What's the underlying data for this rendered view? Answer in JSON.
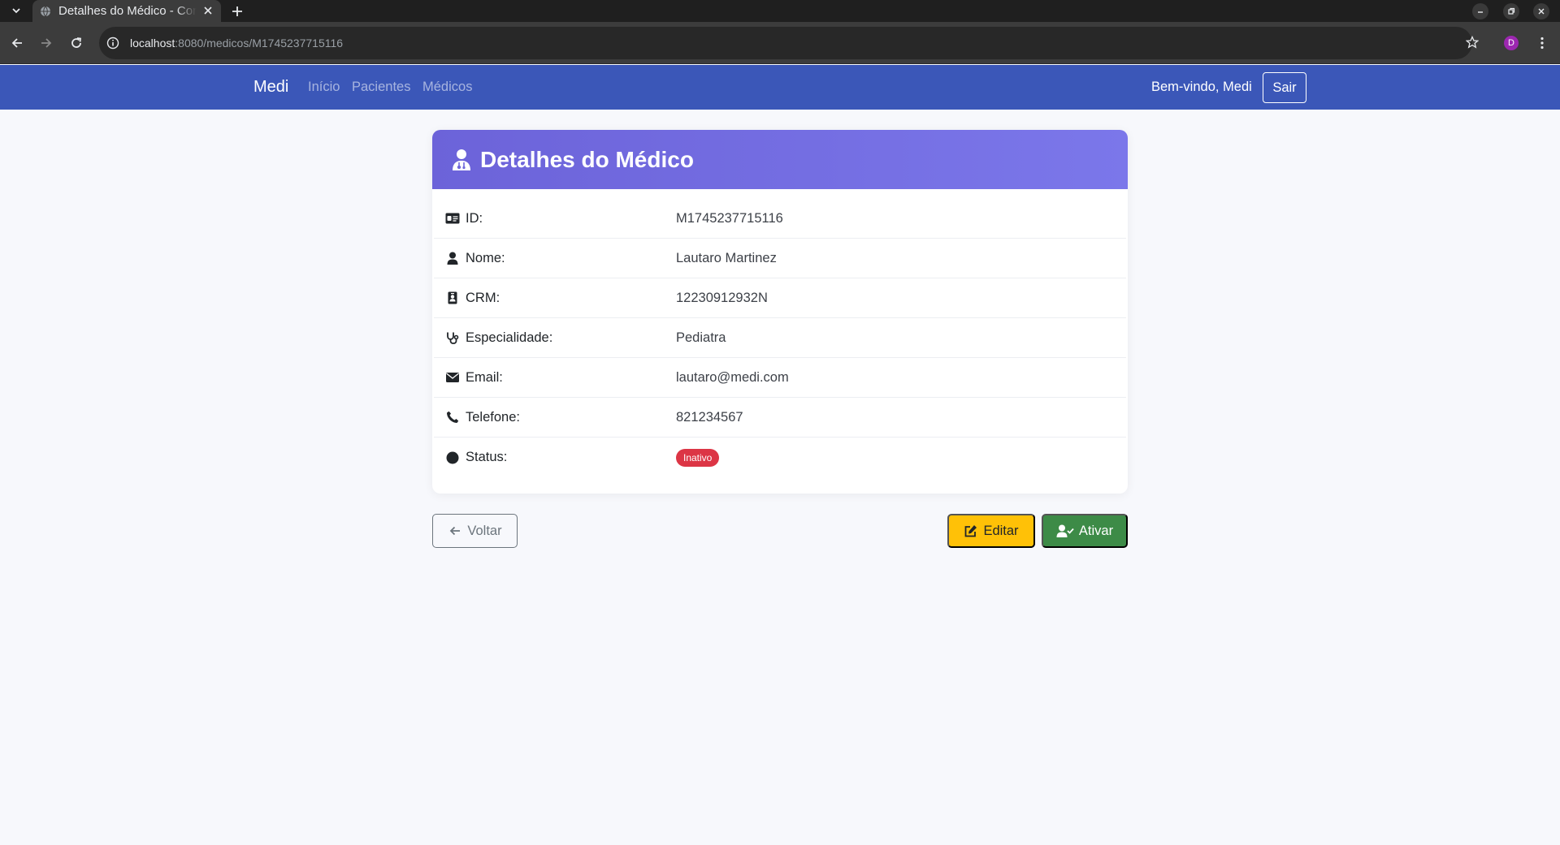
{
  "browser": {
    "tab_title": "Detalhes do Médico - Cons",
    "url_host": "localhost",
    "url_rest": ":8080/medicos/M1745237715116",
    "profile_initial": "D"
  },
  "navbar": {
    "brand": "Medi",
    "links": [
      "Início",
      "Pacientes",
      "Médicos"
    ],
    "welcome": "Bem-vindo, Medi",
    "logout": "Sair"
  },
  "card": {
    "title": "Detalhes do Médico",
    "rows": [
      {
        "label": "ID:",
        "value": "M1745237715116",
        "icon": "id-card-icon"
      },
      {
        "label": "Nome:",
        "value": "Lautaro Martinez",
        "icon": "user-icon"
      },
      {
        "label": "CRM:",
        "value": "12230912932N",
        "icon": "id-badge-icon"
      },
      {
        "label": "Especialidade:",
        "value": "Pediatra",
        "icon": "stethoscope-icon"
      },
      {
        "label": "Email:",
        "value": "lautaro@medi.com",
        "icon": "envelope-icon"
      },
      {
        "label": "Telefone:",
        "value": "821234567",
        "icon": "phone-icon"
      },
      {
        "label": "Status:",
        "value": "Inativo",
        "icon": "circle-icon"
      }
    ],
    "status_color": "#dc3545"
  },
  "actions": {
    "back": "Voltar",
    "edit": "Editar",
    "activate": "Ativar"
  },
  "colors": {
    "navbar": "#3b57b8",
    "header_gradient_start": "#6c63d9",
    "header_gradient_end": "#7b77ea",
    "edit": "#ffc107",
    "activate": "#3d8b47"
  }
}
